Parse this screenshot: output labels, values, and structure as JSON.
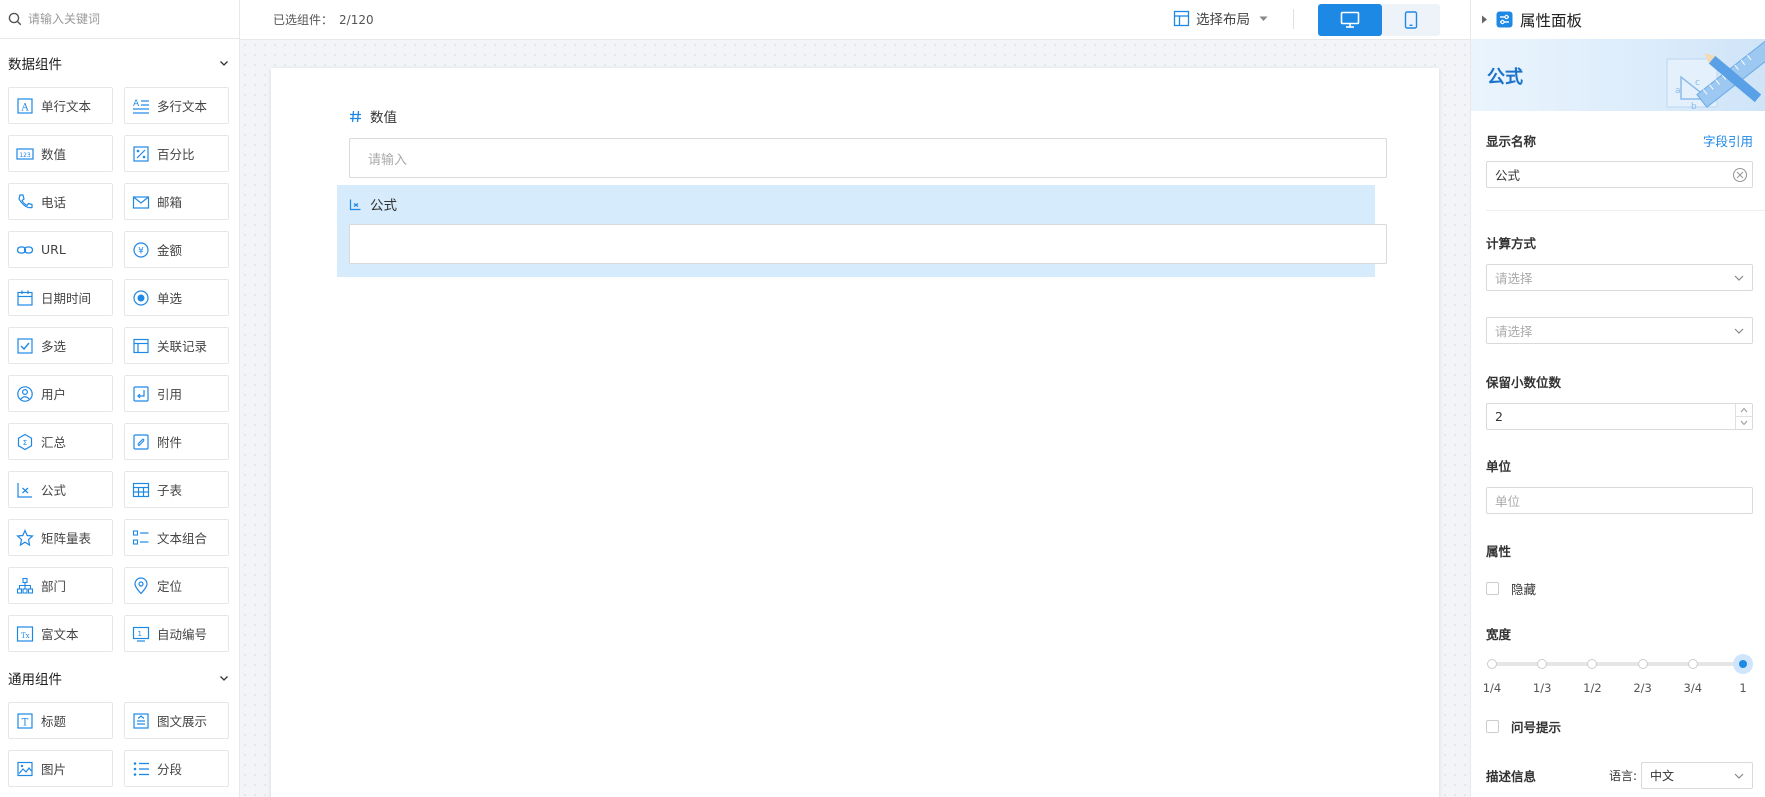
{
  "sidebar": {
    "search_placeholder": "请输入关键词",
    "data_group": {
      "title": "数据组件",
      "items": [
        {
          "label": "单行文本",
          "icon": "text-field-icon"
        },
        {
          "label": "多行文本",
          "icon": "multiline-text-icon"
        },
        {
          "label": "数值",
          "icon": "number-icon"
        },
        {
          "label": "百分比",
          "icon": "percent-icon"
        },
        {
          "label": "电话",
          "icon": "phone-icon"
        },
        {
          "label": "邮箱",
          "icon": "mail-icon"
        },
        {
          "label": "URL",
          "icon": "link-icon"
        },
        {
          "label": "金额",
          "icon": "currency-icon"
        },
        {
          "label": "日期时间",
          "icon": "calendar-icon"
        },
        {
          "label": "单选",
          "icon": "radio-icon"
        },
        {
          "label": "多选",
          "icon": "checkbox-icon"
        },
        {
          "label": "关联记录",
          "icon": "related-record-icon"
        },
        {
          "label": "用户",
          "icon": "user-icon"
        },
        {
          "label": "引用",
          "icon": "quote-icon"
        },
        {
          "label": "汇总",
          "icon": "summary-icon"
        },
        {
          "label": "附件",
          "icon": "attachment-icon"
        },
        {
          "label": "公式",
          "icon": "formula-icon"
        },
        {
          "label": "子表",
          "icon": "subtable-icon"
        },
        {
          "label": "矩阵量表",
          "icon": "matrix-scale-icon"
        },
        {
          "label": "文本组合",
          "icon": "text-combo-icon"
        },
        {
          "label": "部门",
          "icon": "department-icon"
        },
        {
          "label": "定位",
          "icon": "location-icon"
        },
        {
          "label": "富文本",
          "icon": "rich-text-icon"
        },
        {
          "label": "自动编号",
          "icon": "auto-number-icon"
        }
      ]
    },
    "general_group": {
      "title": "通用组件",
      "items": [
        {
          "label": "标题",
          "icon": "title-icon"
        },
        {
          "label": "图文展示",
          "icon": "image-text-icon"
        },
        {
          "label": "图片",
          "icon": "image-icon"
        },
        {
          "label": "分段",
          "icon": "section-icon"
        }
      ]
    }
  },
  "topbar": {
    "selected_label": "已选组件：",
    "selected_count": "2/120",
    "layout_label": "选择布局"
  },
  "form": {
    "fields": [
      {
        "label": "数值",
        "placeholder": "请输入",
        "icon": "hash-icon",
        "selected": false
      },
      {
        "label": "公式",
        "placeholder": "",
        "icon": "formula-icon",
        "selected": true
      }
    ]
  },
  "panel": {
    "title": "属性面板",
    "banner_title": "公式",
    "display_name": {
      "label": "显示名称",
      "link": "字段引用",
      "value": "公式"
    },
    "calc": {
      "label": "计算方式",
      "select1_placeholder": "请选择",
      "select2_placeholder": "请选择"
    },
    "decimals": {
      "label": "保留小数位数",
      "value": "2"
    },
    "unit": {
      "label": "单位",
      "placeholder": "单位"
    },
    "attribute": {
      "label": "属性",
      "hidden_label": "隐藏"
    },
    "width": {
      "label": "宽度",
      "ticks": [
        "1/4",
        "1/3",
        "1/2",
        "2/3",
        "3/4",
        "1"
      ],
      "selected": "1"
    },
    "tooltip_label": "问号提示",
    "description": {
      "label": "描述信息",
      "language_label": "语言:",
      "language_value": "中文"
    }
  },
  "colors": {
    "accent": "#1e88e5",
    "selected_bg": "#d6ebfb"
  }
}
